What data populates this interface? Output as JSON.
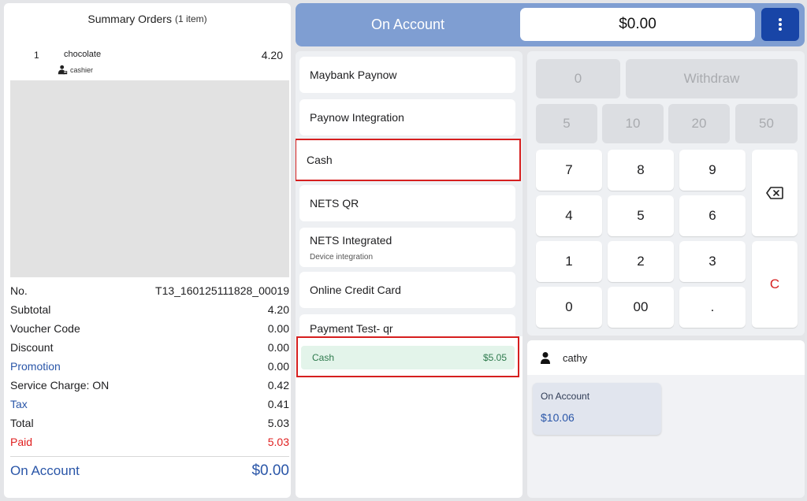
{
  "summary": {
    "title": "Summary Orders",
    "item_count": "(1 item)",
    "items": [
      {
        "qty": "1",
        "name": "chocolate",
        "price": "4.20",
        "staff": "cashier"
      }
    ],
    "rows": [
      {
        "label": "No.",
        "value": "T13_160125111828_00019"
      },
      {
        "label": "Subtotal",
        "value": "4.20"
      },
      {
        "label": "Voucher Code",
        "value": "0.00"
      },
      {
        "label": "Discount",
        "value": "0.00"
      },
      {
        "label": "Promotion",
        "value": "0.00"
      },
      {
        "label": "Service Charge: ON",
        "value": "0.42"
      },
      {
        "label": "Tax",
        "value": "0.41"
      },
      {
        "label": "Total",
        "value": "5.03"
      },
      {
        "label": "Paid",
        "value": "5.03"
      }
    ],
    "footer_label": "On Account",
    "footer_value": "$0.00"
  },
  "header": {
    "title": "On Account",
    "amount": "$0.00"
  },
  "methods": [
    {
      "label": "Maybank Paynow"
    },
    {
      "label": "Paynow Integration"
    },
    {
      "label": "Cash"
    },
    {
      "label": "NETS QR"
    },
    {
      "label": "NETS Integrated",
      "note": "Device integration"
    },
    {
      "label": "Online Credit Card"
    },
    {
      "label": "Payment Test- qr"
    }
  ],
  "paid_line": {
    "method": "Cash",
    "amount": "$5.05"
  },
  "keypad": {
    "quick": [
      "0",
      "Withdraw",
      "5",
      "10",
      "20",
      "50"
    ],
    "digits": [
      "7",
      "8",
      "9",
      "4",
      "5",
      "6",
      "1",
      "2",
      "3",
      "0",
      "00",
      "."
    ],
    "clear": "C"
  },
  "customer": {
    "name": "cathy",
    "account_label": "On Account",
    "account_value": "$10.06"
  },
  "colors": {
    "header_bg": "#7f9ed2",
    "menu_button": "#1845a7",
    "accent_blue": "#2a56a8",
    "selected_outline": "#d61f1f",
    "paid_green": "#2e7a4d"
  }
}
